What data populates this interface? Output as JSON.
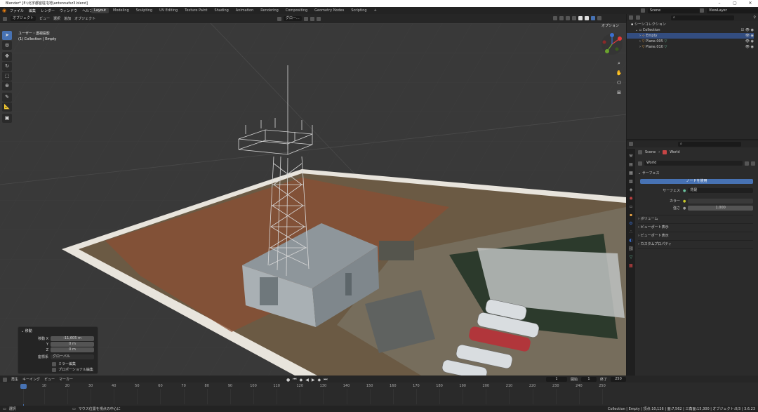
{
  "window": {
    "title": "Blender* [E:\\北宇都宮駐屯地\\antennafsz3.blend]"
  },
  "topbar": {
    "menu": [
      "ファイル",
      "編集",
      "レンダー",
      "ウィンドウ",
      "ヘルプ"
    ],
    "tabs": [
      "Layout",
      "Modeling",
      "Sculpting",
      "UV Editing",
      "Texture Paint",
      "Shading",
      "Animation",
      "Rendering",
      "Compositing",
      "Geometry Nodes",
      "Scripting"
    ],
    "active_tab": "Layout",
    "add_tab": "+",
    "scene": "Scene",
    "view_layer": "ViewLayer"
  },
  "viewport": {
    "mode": "オブジェクト",
    "menus": [
      "ビュー",
      "選択",
      "追加",
      "オブジェクト"
    ],
    "orientation": "グロー...",
    "view_name": "ユーザー・透視投影",
    "view_sub": "(1) Collection | Empty",
    "options": "オプション"
  },
  "op_panel": {
    "title": "移動",
    "move_label": "移動 X",
    "x": "-11,605 m",
    "y_label": "Y",
    "y": "0 m",
    "z_label": "Z",
    "z": "0 m",
    "orient_label": "座標系",
    "orient": "グローバル",
    "mirror": "ミラー編集",
    "proportional": "プロポーショナル編集"
  },
  "outliner": {
    "root": "シーンコレクション",
    "collection": "Collection",
    "items": [
      "Empty",
      "Plane.005",
      "Plane.010"
    ]
  },
  "properties": {
    "breadcrumb_scene": "Scene",
    "breadcrumb_world": "World",
    "world_name": "World",
    "section_surface": "サーフェス",
    "use_nodes": "ノードを使用",
    "surface_label": "サーフェス",
    "surface_value": "背景",
    "color_label": "カラー",
    "strength_label": "強さ",
    "strength_value": "1.000",
    "sections": [
      "ボリューム",
      "ビューポート表示",
      "ビューポート表示",
      "カスタムプロパティ"
    ]
  },
  "timeline": {
    "menus": [
      "再生",
      "キーイング",
      "ビュー",
      "マーカー"
    ],
    "current_frame": "1",
    "start_label": "開始",
    "start": "1",
    "end_label": "終了",
    "end": "250",
    "ticks": [
      "1",
      "10",
      "20",
      "30",
      "40",
      "50",
      "60",
      "70",
      "80",
      "90",
      "100",
      "110",
      "120",
      "130",
      "140",
      "150",
      "160",
      "170",
      "180",
      "190",
      "200",
      "210",
      "220",
      "230",
      "240",
      "250"
    ]
  },
  "statusbar": {
    "left": "選択",
    "mid": "マウス位置を視点の中心に",
    "right": "Collection | Empty | 頂点:10,126 | 面:7,562 | 三角面:15,300 | オブジェクト:0/3 | 3.6.23"
  }
}
